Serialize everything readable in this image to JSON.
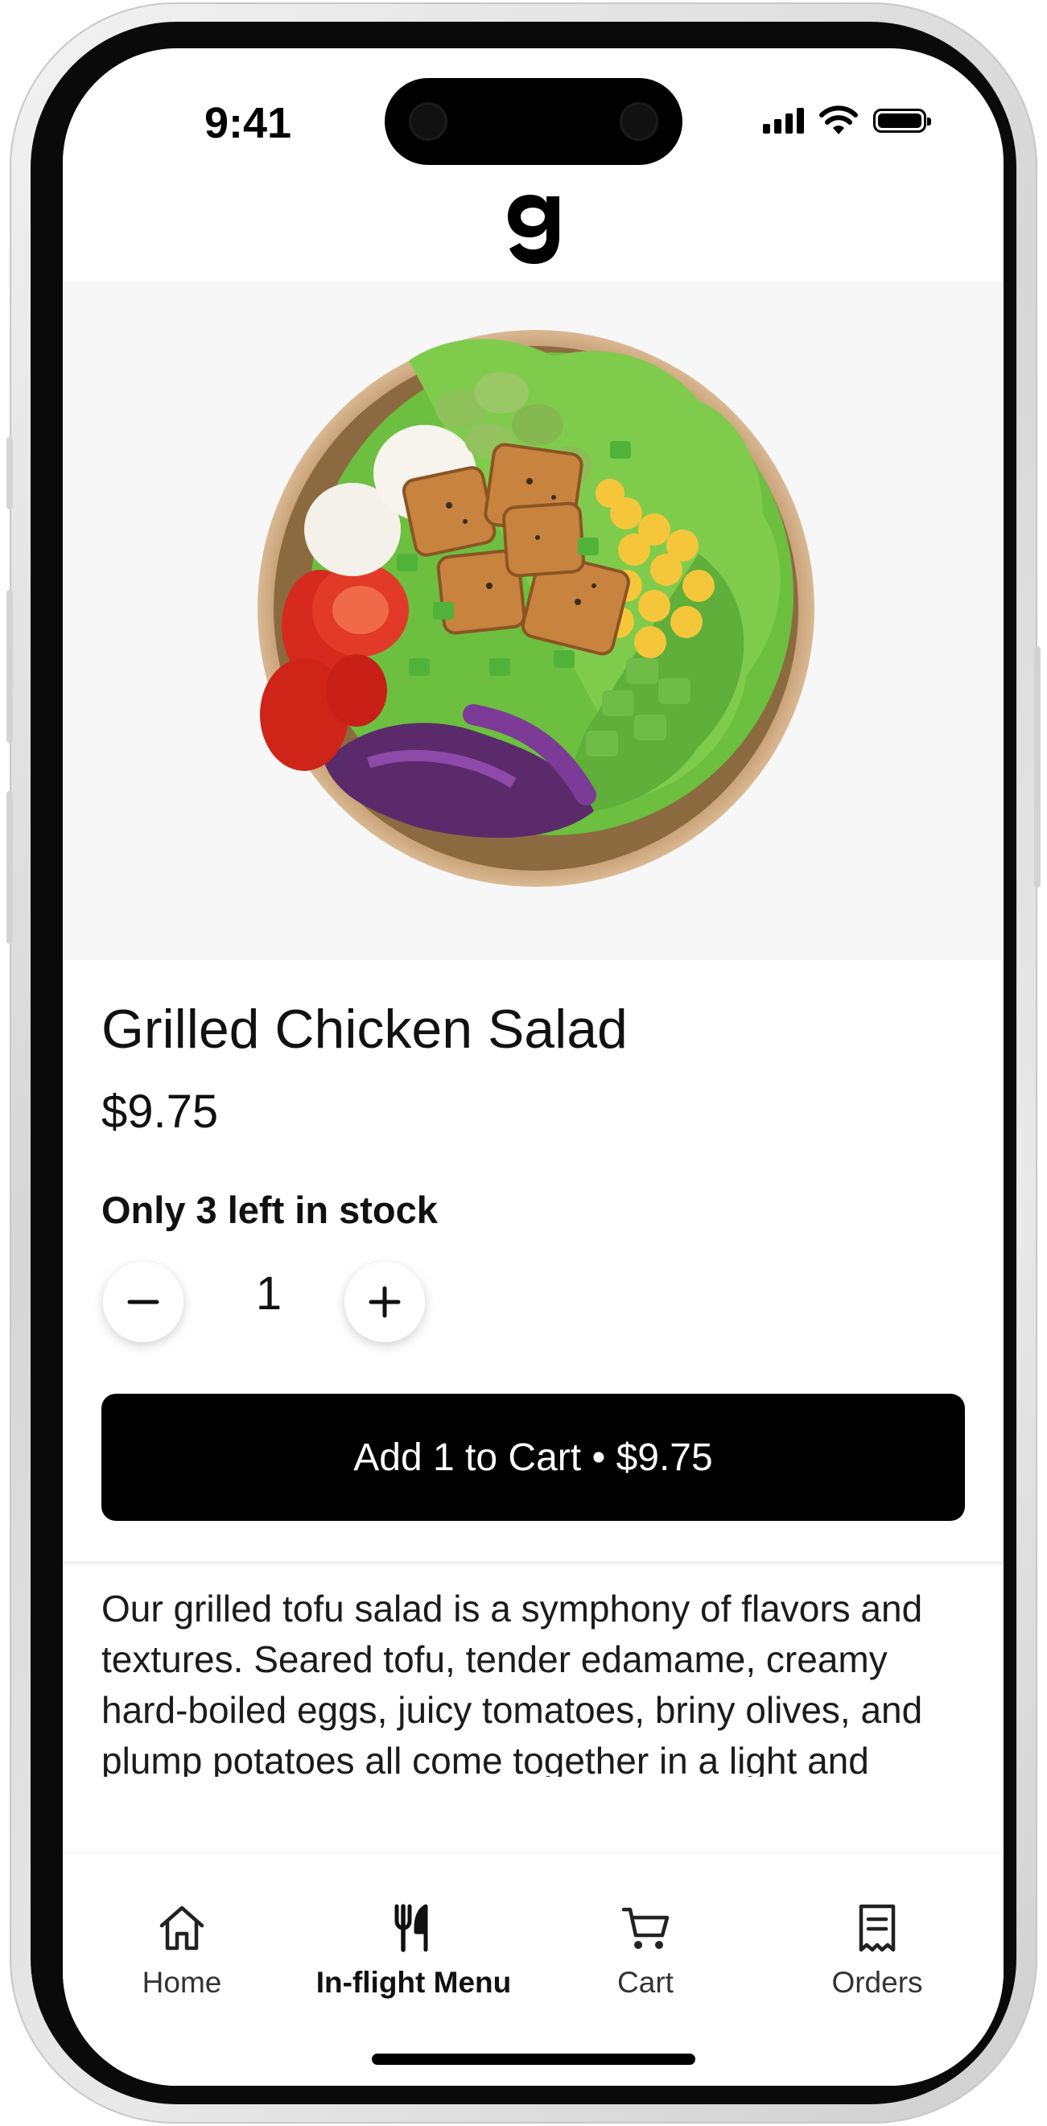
{
  "status_bar": {
    "time": "9:41"
  },
  "header": {
    "logo_icon": "brand-g-logo"
  },
  "product": {
    "image_alt": "grilled salad bowl",
    "title": "Grilled Chicken Salad",
    "price": "$9.75",
    "stock_text": "Only 3 left in stock",
    "quantity": "1",
    "add_button_label": "Add 1 to Cart • $9.75",
    "description": "Our grilled tofu salad is a symphony of flavors and textures. Seared tofu, tender edamame, creamy hard-boiled eggs, juicy tomatoes, briny olives, and plump potatoes all come together in a light and flavorful vinaigrette. It's a taste of"
  },
  "tabs": [
    {
      "label": "Home",
      "icon": "home-icon",
      "active": false
    },
    {
      "label": "In-flight Menu",
      "icon": "fork-knife-icon",
      "active": true
    },
    {
      "label": "Cart",
      "icon": "cart-icon",
      "active": false
    },
    {
      "label": "Orders",
      "icon": "receipt-icon",
      "active": false
    }
  ],
  "colors": {
    "accent": "#000000",
    "hero_bg": "#f7f7f7",
    "text": "#111111"
  }
}
